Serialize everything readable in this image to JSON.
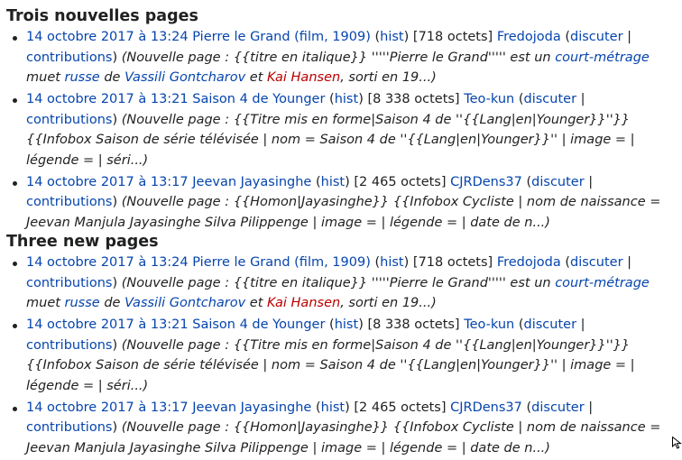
{
  "sections": [
    {
      "heading": "Trois nouvelles pages",
      "items": [
        {
          "date": "14 octobre 2017 à 13:24",
          "title": "Pierre le Grand (film, 1909)",
          "hist": "hist",
          "size": "[718 octets]",
          "user": "Fredojoda",
          "talk": "discuter",
          "contribs": "contributions",
          "summary_prefix": "(Nouvelle page : {{titre en italique}} '''''Pierre le Grand''''' est un ",
          "link1": "court-métrage",
          "text2": " muet ",
          "link2": "russe",
          "text3": " de ",
          "link3": "Vassili Gontcharov",
          "text4": " et ",
          "link4": "Kai Hansen",
          "text5": ", sorti en 19...)"
        },
        {
          "date": "14 octobre 2017 à 13:21",
          "title": "Saison 4 de Younger",
          "hist": "hist",
          "size": "[8 338 octets]",
          "user": "Teo-kun",
          "talk": "discuter",
          "contribs": "contributions",
          "summary": "(Nouvelle page : {{Titre mis en forme|Saison 4 de ''{{Lang|en|Younger}}''}} {{Infobox Saison de série télévisée | nom = Saison 4 de ''{{Lang|en|Younger}}'' | image = | légende = | séri...)"
        },
        {
          "date": "14 octobre 2017 à 13:17",
          "title": "Jeevan Jayasinghe",
          "hist": "hist",
          "size": "[2 465 octets]",
          "user": "CJRDens37",
          "talk": "discuter",
          "contribs": "contributions",
          "summary": "(Nouvelle page : {{Homon|Jayasinghe}} {{Infobox Cycliste | nom de naissance = Jeevan Manjula Jayasinghe Silva Pilippenge | image = | légende = | date de n...)"
        }
      ]
    },
    {
      "heading": "Three new pages",
      "items": [
        {
          "date": "14 octobre 2017 à 13:24",
          "title": "Pierre le Grand (film, 1909)",
          "hist": "hist",
          "size": "[718 octets]",
          "user": "Fredojoda",
          "talk": "discuter",
          "contribs": "contributions",
          "summary_prefix": "(Nouvelle page : {{titre en italique}} '''''Pierre le Grand''''' est un ",
          "link1": "court-métrage",
          "text2": " muet ",
          "link2": "russe",
          "text3": " de ",
          "link3": "Vassili Gontcharov",
          "text4": " et ",
          "link4": "Kai Hansen",
          "text5": ", sorti en 19...)"
        },
        {
          "date": "14 octobre 2017 à 13:21",
          "title": "Saison 4 de Younger",
          "hist": "hist",
          "size": "[8 338 octets]",
          "user": "Teo-kun",
          "talk": "discuter",
          "contribs": "contributions",
          "summary": "(Nouvelle page : {{Titre mis en forme|Saison 4 de ''{{Lang|en|Younger}}''}} {{Infobox Saison de série télévisée | nom = Saison 4 de ''{{Lang|en|Younger}}'' | image = | légende = | séri...)"
        },
        {
          "date": "14 octobre 2017 à 13:17",
          "title": "Jeevan Jayasinghe",
          "hist": "hist",
          "size": "[2 465 octets]",
          "user": "CJRDens37",
          "talk": "discuter",
          "contribs": "contributions",
          "summary": "(Nouvelle page : {{Homon|Jayasinghe}} {{Infobox Cycliste | nom de naissance = Jeevan Manjula Jayasinghe Silva Pilippenge | image = | légende = | date de n...)"
        }
      ]
    }
  ],
  "colors": {
    "link": "#0645ad",
    "redlink": "#ba0000",
    "text": "#202122"
  },
  "icons": {
    "cursor": "mouse-pointer-icon"
  }
}
